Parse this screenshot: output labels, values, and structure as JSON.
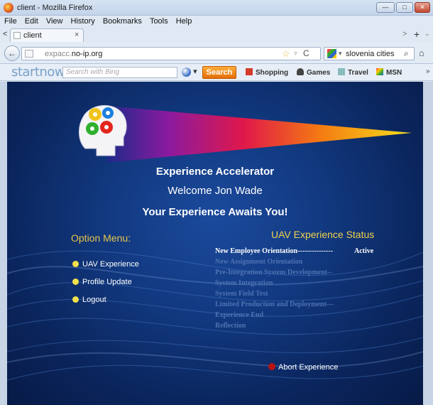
{
  "window": {
    "title": "client - Mozilla Firefox"
  },
  "menu": {
    "items": [
      "File",
      "Edit",
      "View",
      "History",
      "Bookmarks",
      "Tools",
      "Help"
    ]
  },
  "tabs": [
    {
      "label": "client",
      "close": "×"
    }
  ],
  "tab_controls": {
    "back_small": "<",
    "new_tab": "+",
    "scroll_right": ">",
    "list_all": "⌄"
  },
  "nav": {
    "back": "←",
    "url_prefix": "expacc.",
    "url_domain": "no-ip.org",
    "star": "☆",
    "dropdown": "▿",
    "reload": "C",
    "search_value": "slovenia cities",
    "search_engine_dropdown": "▾",
    "search_icon": "⌕",
    "home": "⌂"
  },
  "toolbar": {
    "brand": "startnow",
    "bing_placeholder": "Search with Bing",
    "bing_dropdown": "▾",
    "search_label": "Search",
    "links": [
      "Shopping",
      "Games",
      "Travel",
      "MSN"
    ],
    "more": "»"
  },
  "colors": {
    "accent_yellow": "#f3e04b",
    "status_title": "#f2d14c",
    "abort_red": "#b91414",
    "bg_blue": "#123a82"
  },
  "page": {
    "title": "Experience Accelerator",
    "welcome": "Welcome Jon Wade",
    "tagline": "Your Experience Awaits You!",
    "option_menu_title": "Option Menu:",
    "options": [
      "UAV Experience",
      "Profile Update",
      "Logout"
    ],
    "status_title": "UAV Experience Status",
    "status_rows": [
      {
        "name": "New Employee Orientation---------------",
        "state": "Active"
      },
      {
        "name": "New Assignment Orientation",
        "state": ""
      },
      {
        "name": "Pre-Integration System Development--",
        "state": ""
      },
      {
        "name": "System Integration",
        "state": ""
      },
      {
        "name": "System Field Test",
        "state": ""
      },
      {
        "name": "Limited Production and Deployment---",
        "state": ""
      },
      {
        "name": "Experience End",
        "state": ""
      },
      {
        "name": "Reflection",
        "state": ""
      }
    ],
    "abort_label": "Abort Experience"
  }
}
